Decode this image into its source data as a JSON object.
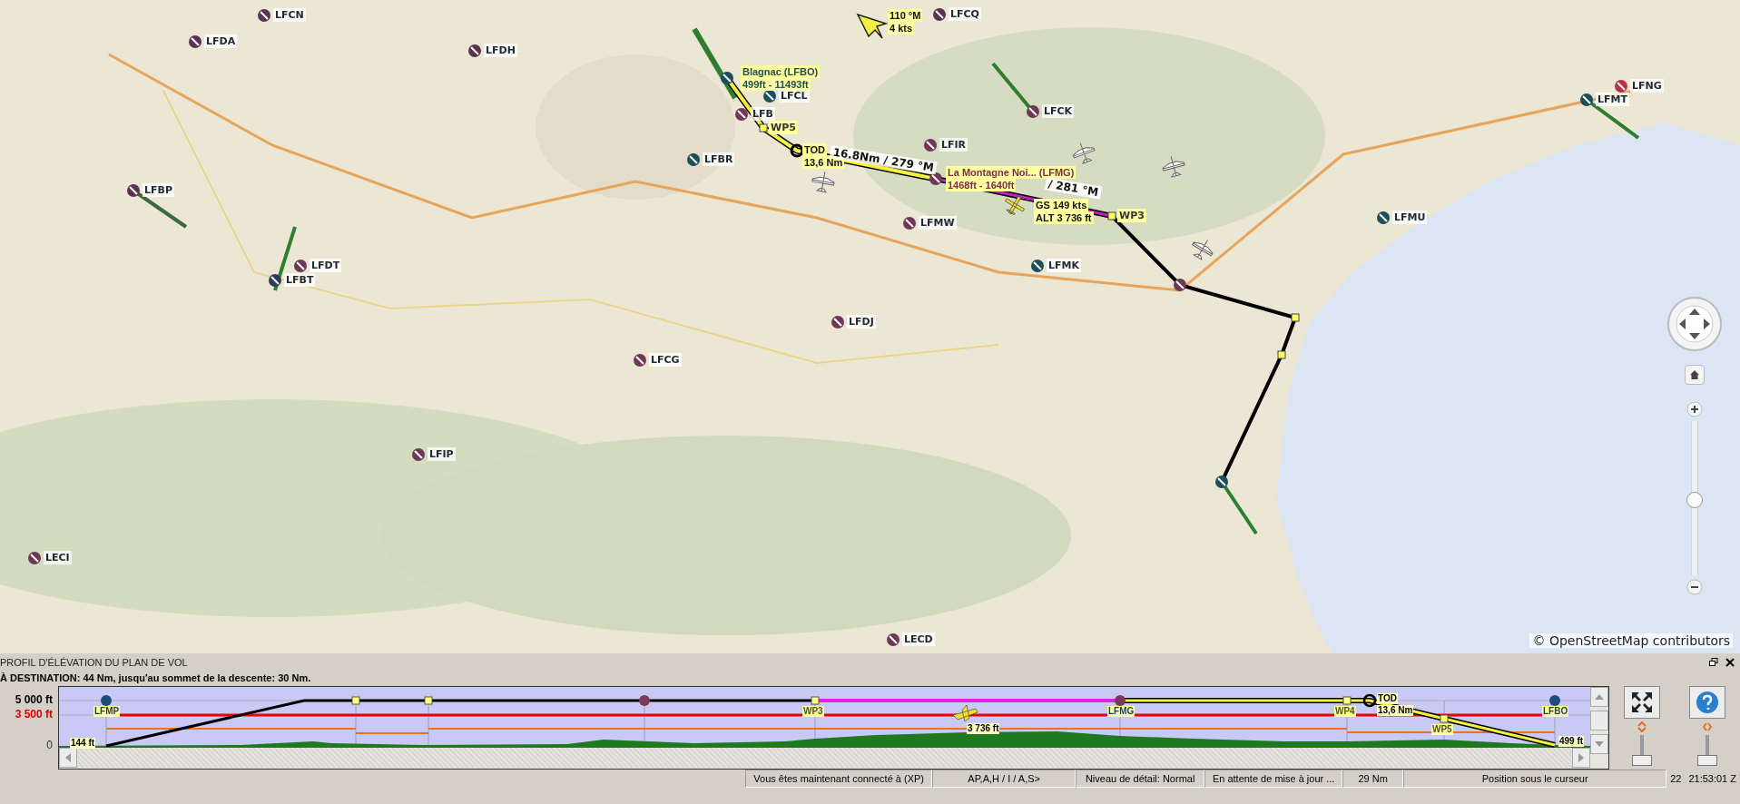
{
  "map": {
    "airports": [
      {
        "code": "LFCN",
        "color": "#5a3350"
      },
      {
        "code": "LFCQ",
        "color": "#5a3350"
      },
      {
        "code": "LFDA",
        "color": "#5a3350"
      },
      {
        "code": "LFDH",
        "color": "#5a3350"
      },
      {
        "code": "LFNG",
        "color": "#b8324a"
      },
      {
        "code": "LFCL",
        "color": "#1d4e5b"
      },
      {
        "code": "LFMT",
        "color": "#1d4e5b"
      },
      {
        "code": "LFCK",
        "color": "#6e3856"
      },
      {
        "code": "LFB",
        "color": "#6e3856"
      },
      {
        "code": "LFIR",
        "color": "#6e3856"
      },
      {
        "code": "LFBR",
        "color": "#1d4e5b"
      },
      {
        "code": "LFBP",
        "color": "#5a3350"
      },
      {
        "code": "LFMU",
        "color": "#1d4e5b"
      },
      {
        "code": "LFMW",
        "color": "#6e3856"
      },
      {
        "code": "LFDT",
        "color": "#6e3856"
      },
      {
        "code": "LFMK",
        "color": "#1d4e5b"
      },
      {
        "code": "LFBT",
        "color": "#2c3e5a"
      },
      {
        "code": "LFDJ",
        "color": "#6e3856"
      },
      {
        "code": "LFCG",
        "color": "#6e3856"
      },
      {
        "code": "LFIP",
        "color": "#6e3856"
      },
      {
        "code": "LECI",
        "color": "#6e3856"
      },
      {
        "code": "LECD",
        "color": "#6e3856"
      }
    ],
    "wind": {
      "direction": "110 °M",
      "speed": "4 kts"
    },
    "departure": {
      "name": "Blagnac (LFBO)",
      "elevation": "499ft - 11493ft"
    },
    "destination": {
      "name": "La Montagne Noi... (LFMG)",
      "elevation": "1468ft - 1640ft"
    },
    "waypoints": [
      {
        "label": "WP5"
      },
      {
        "label": "WP3"
      }
    ],
    "top_of_descent": {
      "label": "TOD",
      "distance": "13,6 Nm"
    },
    "leg_labels": [
      {
        "text": "16.8Nm / 279 °M"
      },
      {
        "text": "/ 281 °M"
      }
    ],
    "aircraft": {
      "ground_speed": "GS 149 kts",
      "altitude": "ALT 3 736 ft"
    },
    "zoom_slider": {
      "level": 0.49
    },
    "attribution": "© OpenStreetMap contributors"
  },
  "profile_panel": {
    "title": "PROFIL D'ÉLÉVATION DU PLAN DE VOL",
    "summary": "À DESTINATION: 44 Nm, jusqu'au sommet de la descente: 30 Nm.",
    "altitude_labels": [
      {
        "text": "5 000 ft",
        "kind": "cruise"
      },
      {
        "text": "3 500 ft",
        "kind": "safe"
      },
      {
        "text": "0",
        "kind": "ground"
      }
    ],
    "waypoints": [
      {
        "label": "LFMP",
        "kind": "airport"
      },
      {
        "label": "WP3",
        "kind": "waypoint"
      },
      {
        "label": "LFMG",
        "kind": "airport"
      },
      {
        "label": "WP4",
        "kind": "waypoint"
      },
      {
        "label": "WP5",
        "kind": "waypoint"
      },
      {
        "label": "LFBO",
        "kind": "airport"
      }
    ],
    "top_of_descent": {
      "label": "TOD",
      "distance": "13,6 Nm"
    },
    "start_altitude": "144 ft",
    "end_altitude": "499 ft",
    "aircraft_altitude": "3 736 ft",
    "side_sliders": [
      {
        "level": 0
      },
      {
        "level": 0
      }
    ]
  },
  "status_bar": [
    {
      "text": "Vous êtes maintenant connecté à (XP)"
    },
    {
      "text": "AP,A,H / I / A,S>"
    },
    {
      "text": "Niveau de détail: Normal"
    },
    {
      "text": "En attente de mise à jour ..."
    },
    {
      "text": "29 Nm"
    },
    {
      "text": "Position sous le curseur"
    },
    {
      "text": "22"
    },
    {
      "text": "21:53:01 Z"
    }
  ]
}
